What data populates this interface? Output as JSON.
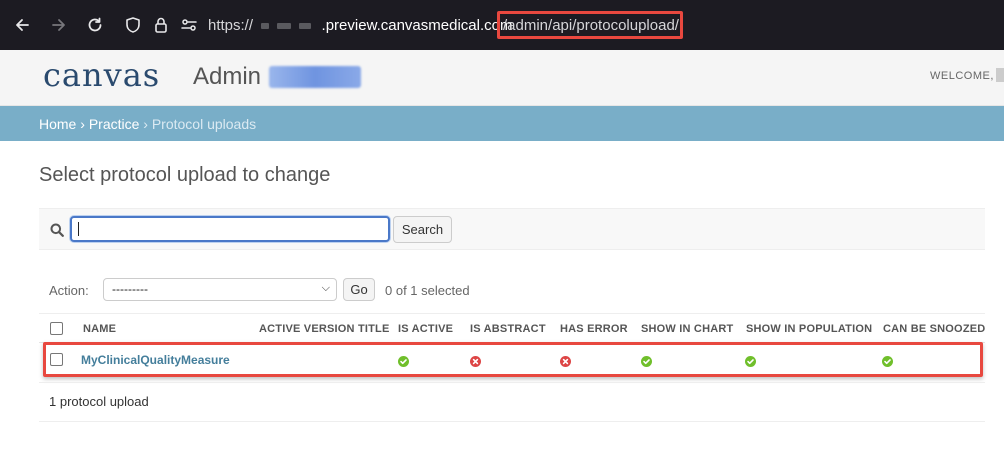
{
  "browser": {
    "url_prefix": "https://",
    "url_host": ".preview.canvasmedical.com",
    "url_path": "/admin/api/protocolupload/"
  },
  "header": {
    "logo": "canvas",
    "title": "Admin",
    "welcome": "WELCOME,"
  },
  "breadcrumbs": {
    "home": "Home",
    "sep1": " › ",
    "practice": "Practice",
    "sep2": " › ",
    "current": "Protocol uploads"
  },
  "main": {
    "title": "Select protocol upload to change",
    "search_button": "Search",
    "action_label": "Action:",
    "action_selected": "---------",
    "go_button": "Go",
    "selected_count": "0 of 1 selected",
    "columns": [
      "NAME",
      "ACTIVE VERSION TITLE",
      "IS ACTIVE",
      "IS ABSTRACT",
      "HAS ERROR",
      "SHOW IN CHART",
      "SHOW IN POPULATION",
      "CAN BE SNOOZED"
    ],
    "rows": [
      {
        "name": "MyClinicalQualityMeasure",
        "active_version_title": "",
        "is_active": true,
        "is_abstract": false,
        "has_error": false,
        "show_in_chart": true,
        "show_in_population": true,
        "can_be_snoozed": true
      }
    ],
    "paginator": "1 protocol upload"
  },
  "colors": {
    "breadcrumb_bg": "#79aec8",
    "link": "#447e9b",
    "yes": "#70bf2b",
    "no": "#dd4646",
    "highlight": "#e8483f"
  }
}
